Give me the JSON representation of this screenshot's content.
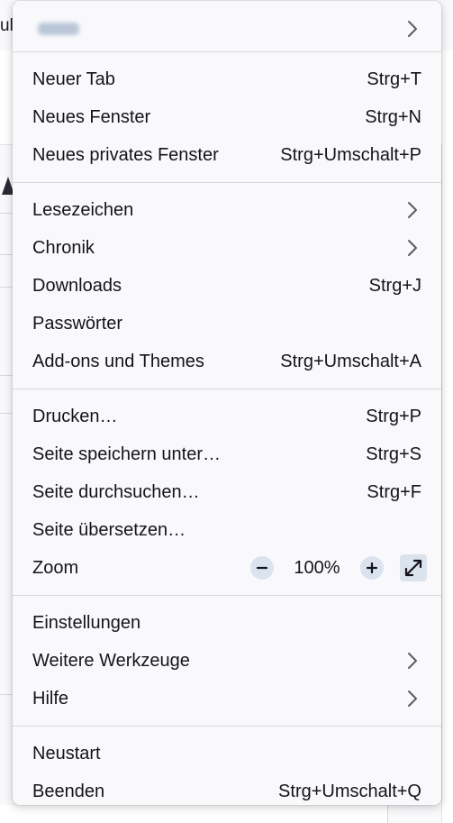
{
  "background": {
    "tab_fragment": "ul"
  },
  "account": {
    "icon": "chevron-right-icon"
  },
  "groups": [
    [
      {
        "id": "new-tab",
        "label": "Neuer Tab",
        "shortcut": "Strg+T"
      },
      {
        "id": "new-window",
        "label": "Neues Fenster",
        "shortcut": "Strg+N"
      },
      {
        "id": "new-private-window",
        "label": "Neues privates Fenster",
        "shortcut": "Strg+Umschalt+P"
      }
    ],
    [
      {
        "id": "bookmarks",
        "label": "Lesezeichen",
        "submenu": true
      },
      {
        "id": "history",
        "label": "Chronik",
        "submenu": true
      },
      {
        "id": "downloads",
        "label": "Downloads",
        "shortcut": "Strg+J"
      },
      {
        "id": "passwords",
        "label": "Passwörter"
      },
      {
        "id": "addons-themes",
        "label": "Add-ons und Themes",
        "shortcut": "Strg+Umschalt+A"
      }
    ],
    [
      {
        "id": "print",
        "label": "Drucken…",
        "shortcut": "Strg+P"
      },
      {
        "id": "save-page",
        "label": "Seite speichern unter…",
        "shortcut": "Strg+S"
      },
      {
        "id": "find-in-page",
        "label": "Seite durchsuchen…",
        "shortcut": "Strg+F"
      },
      {
        "id": "translate-page",
        "label": "Seite übersetzen…"
      },
      {
        "id": "zoom",
        "label": "Zoom",
        "zoom": true
      }
    ],
    [
      {
        "id": "settings",
        "label": "Einstellungen"
      },
      {
        "id": "more-tools",
        "label": "Weitere Werkzeuge",
        "submenu": true
      },
      {
        "id": "help",
        "label": "Hilfe",
        "submenu": true
      }
    ],
    [
      {
        "id": "restart",
        "label": "Neustart"
      },
      {
        "id": "quit",
        "label": "Beenden",
        "shortcut": "Strg+Umschalt+Q"
      }
    ]
  ],
  "zoom": {
    "value": "100%",
    "zoom_out_icon": "minus-icon",
    "zoom_in_icon": "plus-icon",
    "fullscreen_icon": "fullscreen-expand-icon"
  },
  "colors": {
    "menu_background": "#f9f9fb",
    "separator": "#d7d7db",
    "text": "#15141a",
    "icon": "#5b5b66",
    "zoom_button_bg": "#dbe3ee"
  }
}
